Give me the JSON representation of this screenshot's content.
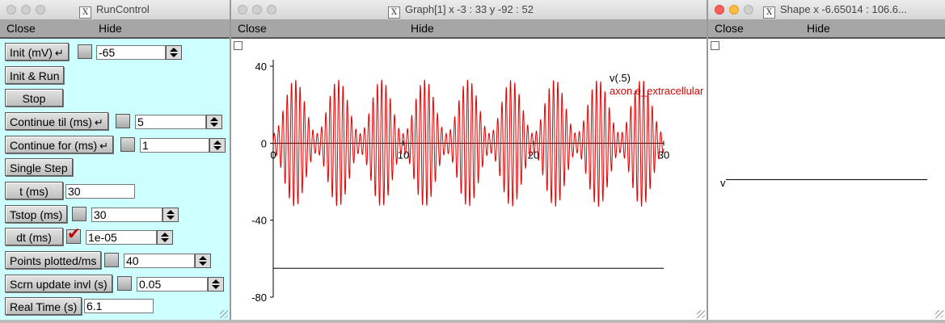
{
  "runcontrol": {
    "title": "RunControl",
    "menu": {
      "close": "Close",
      "hide": "Hide"
    },
    "init": {
      "label": "Init (mV)",
      "value": "-65"
    },
    "init_run": "Init & Run",
    "stop": "Stop",
    "continue_til": {
      "label": "Continue til (ms)",
      "value": "5"
    },
    "continue_for": {
      "label": "Continue for (ms)",
      "value": "1"
    },
    "single_step": "Single Step",
    "t": {
      "label": "t (ms)",
      "value": "30"
    },
    "tstop": {
      "label": "Tstop (ms)",
      "value": "30"
    },
    "dt": {
      "label": "dt (ms)",
      "value": "1e-05",
      "checked": true
    },
    "points_plotted": {
      "label": "Points plotted/ms",
      "value": "40"
    },
    "scrn_update": {
      "label": "Scrn update invl (s)",
      "value": "0.05"
    },
    "real_time": {
      "label": "Real Time (s)",
      "value": "6.1"
    }
  },
  "graph": {
    "title": "Graph[1]  x -3 : 33  y -92 : 52",
    "menu": {
      "close": "Close",
      "hide": "Hide"
    },
    "y_ticks": [
      "40",
      "0",
      "-40",
      "-80"
    ],
    "x_ticks": [
      "0",
      "10",
      "20",
      "30"
    ],
    "legend": [
      "v(.5)",
      "axon.e_extracellular"
    ],
    "colors": {
      "trace": "#e00000",
      "axis": "#000000"
    }
  },
  "shape": {
    "title": "Shape  x -6.65014 : 106.6...",
    "menu": {
      "close": "Close",
      "hide": "Hide"
    },
    "label": "v"
  },
  "chart_data": {
    "type": "line",
    "x_range": [
      0,
      30
    ],
    "y_range": [
      -80,
      40
    ],
    "series": [
      {
        "name": "v(.5)",
        "color": "#000000",
        "x": [
          0,
          30
        ],
        "y": [
          -65,
          -65
        ]
      },
      {
        "name": "axon.e_extracellular",
        "color": "#e00000",
        "oscillation_period_ms": 0.33,
        "amplitude_envelope": [
          5,
          33
        ],
        "envelope_period_ms": 3.33,
        "x_range": [
          0,
          30
        ]
      }
    ],
    "grid": false
  }
}
